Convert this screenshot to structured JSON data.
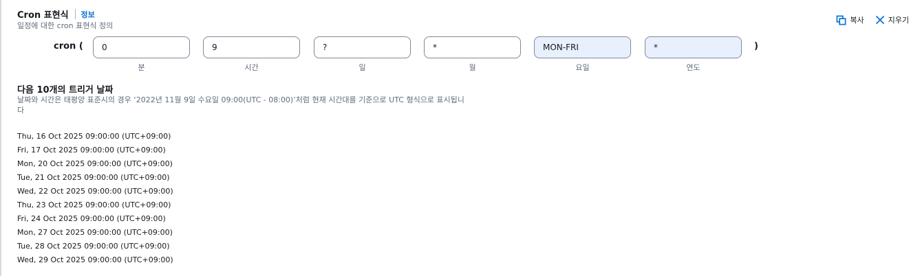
{
  "header": {
    "title": "Cron 표현식",
    "info_link": "정보",
    "description": "일정에 대한 cron 표현식 정의"
  },
  "actions": {
    "copy_label": "복사",
    "clear_label": "지우기"
  },
  "cron": {
    "prefix": "cron (",
    "suffix": ")",
    "fields": [
      {
        "value": "0",
        "label": "분"
      },
      {
        "value": "9",
        "label": "시간"
      },
      {
        "value": "?",
        "label": "일"
      },
      {
        "value": "*",
        "label": "월"
      },
      {
        "value": "MON-FRI",
        "label": "요일"
      },
      {
        "value": "*",
        "label": "연도"
      }
    ]
  },
  "triggers": {
    "title": "다음 10개의 트리거 날짜",
    "description": "날짜와 시간은 태평양 표준시의 경우 ‘2022년 11월 9일 수요일 09:00(UTC - 08:00)’처럼 현재 시간대를 기준으로 UTC 형식으로 표시됩니다",
    "dates": [
      "Thu, 16 Oct 2025 09:00:00 (UTC+09:00)",
      "Fri, 17 Oct 2025 09:00:00 (UTC+09:00)",
      "Mon, 20 Oct 2025 09:00:00 (UTC+09:00)",
      "Tue, 21 Oct 2025 09:00:00 (UTC+09:00)",
      "Wed, 22 Oct 2025 09:00:00 (UTC+09:00)",
      "Thu, 23 Oct 2025 09:00:00 (UTC+09:00)",
      "Fri, 24 Oct 2025 09:00:00 (UTC+09:00)",
      "Mon, 27 Oct 2025 09:00:00 (UTC+09:00)",
      "Tue, 28 Oct 2025 09:00:00 (UTC+09:00)",
      "Wed, 29 Oct 2025 09:00:00 (UTC+09:00)"
    ]
  },
  "colors": {
    "link": "#0972d3",
    "highlight_field_bg": "#e9f0fd",
    "secondary_text": "#5f6b7a"
  },
  "icons": [
    "copy-icon",
    "close-icon"
  ]
}
